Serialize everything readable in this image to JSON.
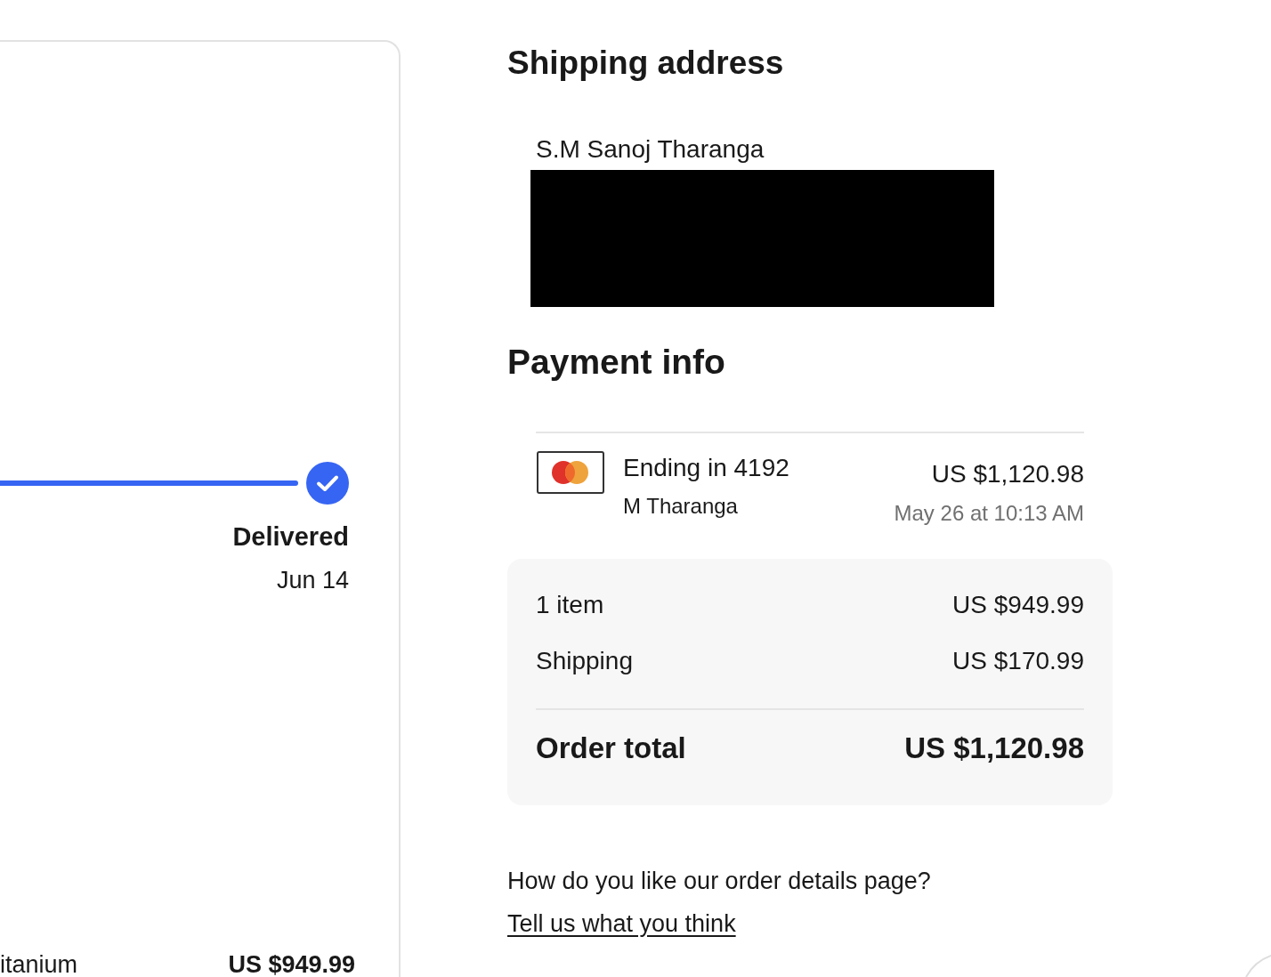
{
  "order_card": {
    "tracker": {
      "steps": [
        {
          "label": "Delivered",
          "date": "Jun 14",
          "completed": true
        }
      ]
    },
    "item": {
      "title": "itanium",
      "price": "US $949.99"
    }
  },
  "shipping_address": {
    "title": "Shipping address",
    "name": "S.M Sanoj Tharanga",
    "address_redacted": true
  },
  "payment_info": {
    "title": "Payment info",
    "card": {
      "ending": "Ending in 4192",
      "holder": "M Tharanga",
      "amount": "US $1,120.98",
      "date": "May 26 at 10:13 AM"
    }
  },
  "order_summary": {
    "rows": [
      {
        "label": "1 item",
        "value": "US $949.99"
      },
      {
        "label": "Shipping",
        "value": "US $170.99"
      }
    ],
    "total": {
      "label": "Order total",
      "value": "US $1,120.98"
    }
  },
  "feedback": {
    "question": "How do you like our order details page?",
    "link": "Tell us what you think"
  }
}
